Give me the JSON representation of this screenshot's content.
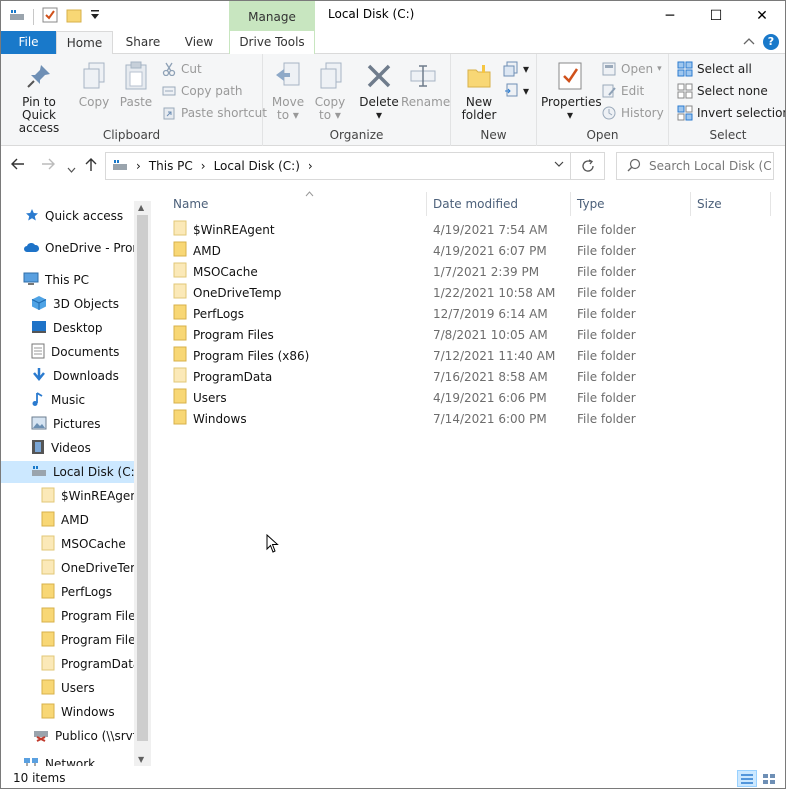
{
  "window": {
    "title": "Local Disk (C:)",
    "contextual_group": "Manage",
    "controls": {
      "minimize": "─",
      "maximize": "☐",
      "close": "✕"
    }
  },
  "tabs": {
    "file": "File",
    "home": "Home",
    "share": "Share",
    "view": "View",
    "drive_tools": "Drive Tools",
    "help": "?"
  },
  "ribbon": {
    "clipboard": {
      "label": "Clipboard",
      "pin_line1": "Pin to Quick",
      "pin_line2": "access",
      "copy": "Copy",
      "paste": "Paste",
      "cut": "Cut",
      "copy_path": "Copy path",
      "paste_shortcut": "Paste shortcut"
    },
    "organize": {
      "label": "Organize",
      "move_to_line1": "Move",
      "move_to_line2": "to",
      "copy_to_line1": "Copy",
      "copy_to_line2": "to",
      "delete": "Delete",
      "rename": "Rename"
    },
    "new": {
      "label": "New",
      "new_folder_line1": "New",
      "new_folder_line2": "folder"
    },
    "open": {
      "label": "Open",
      "properties": "Properties",
      "open": "Open",
      "edit": "Edit",
      "history": "History"
    },
    "select": {
      "label": "Select",
      "select_all": "Select all",
      "select_none": "Select none",
      "invert": "Invert selection"
    }
  },
  "address": {
    "crumbs": [
      "This PC",
      "Local Disk (C:)"
    ],
    "search_placeholder": "Search Local Disk (C:)"
  },
  "nav": {
    "items": [
      {
        "label": "Quick access",
        "icon": "star-icon"
      },
      {
        "label": "OneDrive - Prom",
        "icon": "cloud-icon"
      },
      {
        "label": "This PC",
        "icon": "computer-icon"
      },
      {
        "label": "3D Objects",
        "icon": "cube-icon"
      },
      {
        "label": "Desktop",
        "icon": "desktop-icon"
      },
      {
        "label": "Documents",
        "icon": "documents-icon"
      },
      {
        "label": "Downloads",
        "icon": "download-icon"
      },
      {
        "label": "Music",
        "icon": "music-icon"
      },
      {
        "label": "Pictures",
        "icon": "pictures-icon"
      },
      {
        "label": "Videos",
        "icon": "videos-icon"
      },
      {
        "label": "Local Disk (C:)",
        "icon": "drive-icon"
      },
      {
        "label": "$WinREAgent",
        "icon": "folder-icon"
      },
      {
        "label": "AMD",
        "icon": "folder-icon"
      },
      {
        "label": "MSOCache",
        "icon": "folder-icon"
      },
      {
        "label": "OneDriveTemp",
        "icon": "folder-icon"
      },
      {
        "label": "PerfLogs",
        "icon": "folder-icon"
      },
      {
        "label": "Program Files",
        "icon": "folder-icon"
      },
      {
        "label": "Program Files",
        "icon": "folder-icon"
      },
      {
        "label": "ProgramData",
        "icon": "folder-icon"
      },
      {
        "label": "Users",
        "icon": "folder-icon"
      },
      {
        "label": "Windows",
        "icon": "folder-icon"
      },
      {
        "label": "Publico (\\\\srvfs",
        "icon": "network-drive-icon"
      },
      {
        "label": "Network",
        "icon": "network-icon"
      }
    ]
  },
  "columns": {
    "name": "Name",
    "date": "Date modified",
    "type": "Type",
    "size": "Size"
  },
  "files": [
    {
      "name": "$WinREAgent",
      "date": "4/19/2021 7:54 AM",
      "type": "File folder"
    },
    {
      "name": "AMD",
      "date": "4/19/2021 6:07 PM",
      "type": "File folder"
    },
    {
      "name": "MSOCache",
      "date": "1/7/2021 2:39 PM",
      "type": "File folder"
    },
    {
      "name": "OneDriveTemp",
      "date": "1/22/2021 10:58 AM",
      "type": "File folder"
    },
    {
      "name": "PerfLogs",
      "date": "12/7/2019 6:14 AM",
      "type": "File folder"
    },
    {
      "name": "Program Files",
      "date": "7/8/2021 10:05 AM",
      "type": "File folder"
    },
    {
      "name": "Program Files (x86)",
      "date": "7/12/2021 11:40 AM",
      "type": "File folder"
    },
    {
      "name": "ProgramData",
      "date": "7/16/2021 8:58 AM",
      "type": "File folder"
    },
    {
      "name": "Users",
      "date": "4/19/2021 6:06 PM",
      "type": "File folder"
    },
    {
      "name": "Windows",
      "date": "7/14/2021 6:00 PM",
      "type": "File folder"
    }
  ],
  "status": {
    "count": "10 items"
  },
  "colors": {
    "accent": "#1979ca",
    "selection": "#cce8ff",
    "manage": "#c8e6c0",
    "folder": "#f8d775"
  }
}
